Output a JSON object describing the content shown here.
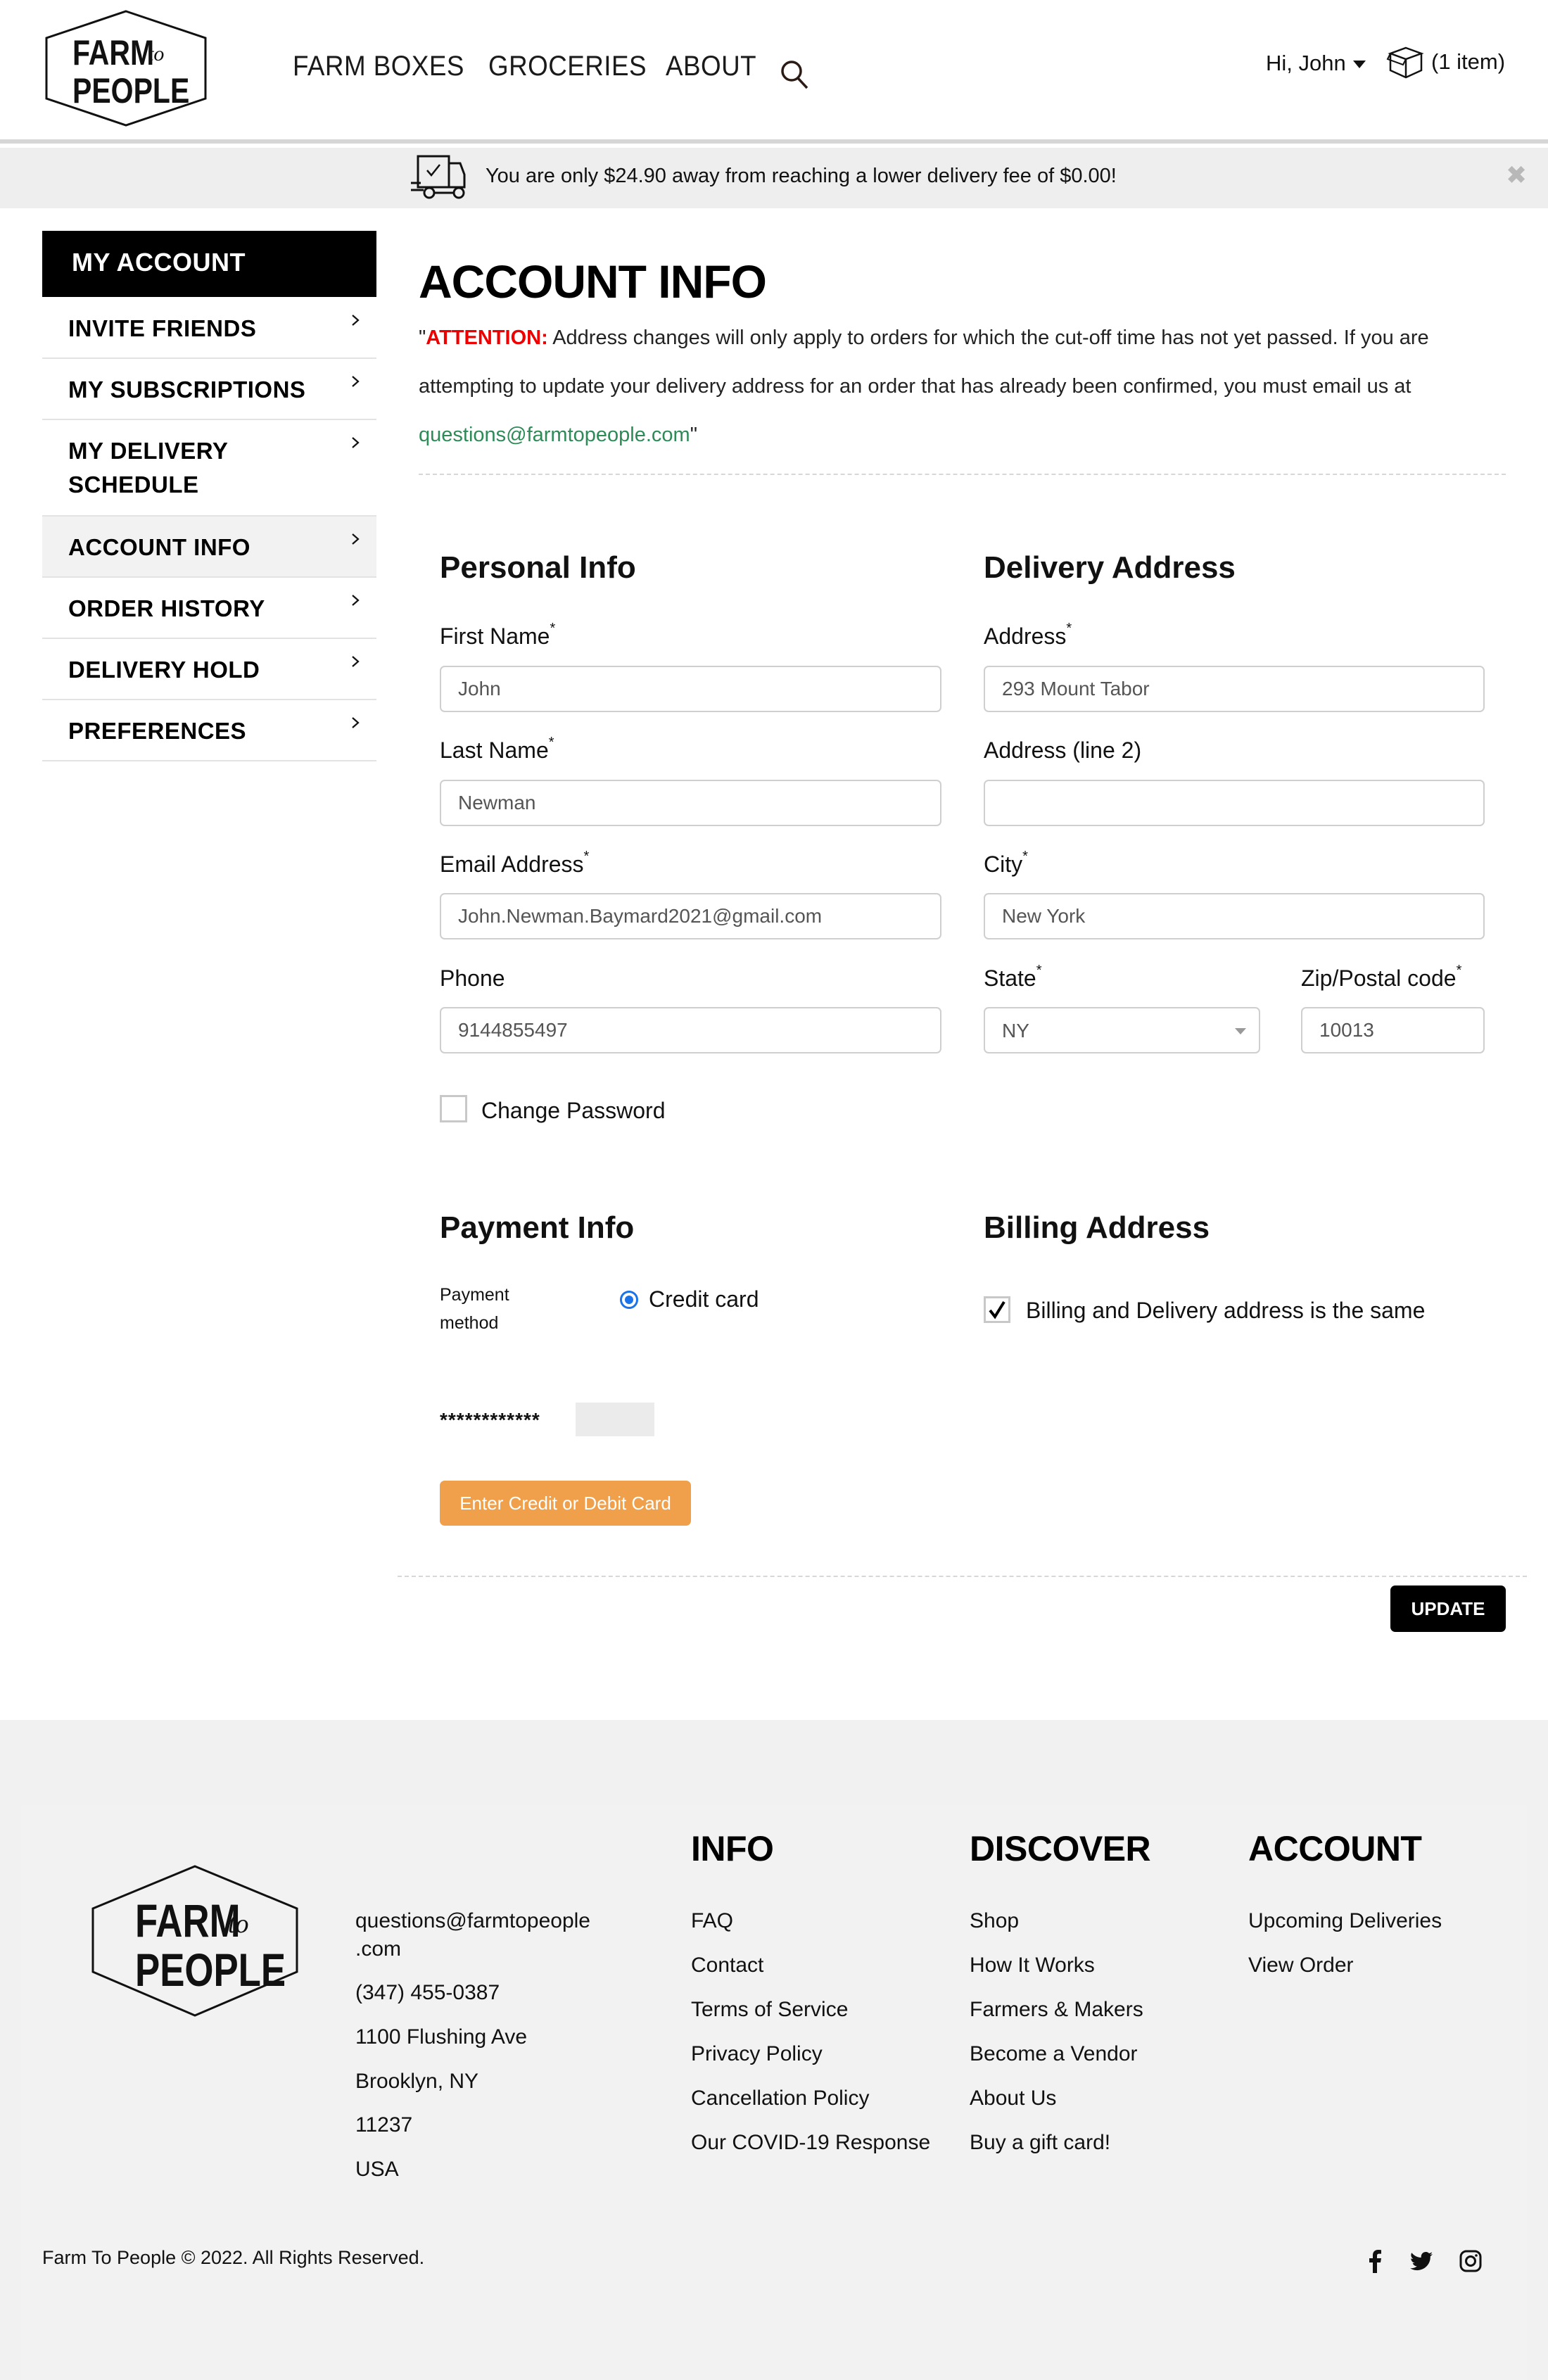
{
  "header": {
    "logo": {
      "line1": "FARM",
      "to": "to",
      "line2": "PEOPLE"
    },
    "nav": [
      "FARM BOXES",
      "GROCERIES",
      "ABOUT"
    ],
    "greeting": "Hi, John",
    "cart_label": "(1 item)"
  },
  "banner": {
    "message": "You are only $24.90 away from reaching a lower delivery fee of $0.00!",
    "close": "✖"
  },
  "sidebar": {
    "title": "MY ACCOUNT",
    "items": [
      {
        "label": "INVITE FRIENDS",
        "active": false
      },
      {
        "label": "MY SUBSCRIPTIONS",
        "active": false
      },
      {
        "label": "MY DELIVERY SCHEDULE",
        "active": false
      },
      {
        "label": "ACCOUNT INFO",
        "active": true
      },
      {
        "label": "ORDER HISTORY",
        "active": false
      },
      {
        "label": "DELIVERY HOLD",
        "active": false
      },
      {
        "label": "PREFERENCES",
        "active": false
      }
    ]
  },
  "main": {
    "title": "ACCOUNT INFO",
    "attention": {
      "open_quote": "\"",
      "label": "ATTENTION:",
      "text": " Address changes will only apply to orders for which the cut-off time has not yet passed. If you are attempting to update your delivery address for an order that has already been confirmed, you must email us at ",
      "email": "questions@farmtopeople.com",
      "close_quote": "\""
    },
    "personal": {
      "title": "Personal Info",
      "first_name": {
        "label": "First Name",
        "required": "*",
        "value": "John"
      },
      "last_name": {
        "label": "Last Name",
        "required": "*",
        "value": "Newman"
      },
      "email": {
        "label": "Email Address",
        "required": "*",
        "value": "John.Newman.Baymard2021@gmail.com"
      },
      "phone": {
        "label": "Phone",
        "value": "9144855497"
      },
      "change_password": {
        "label": "Change Password",
        "checked": false
      }
    },
    "delivery": {
      "title": "Delivery Address",
      "address": {
        "label": "Address",
        "required": "*",
        "value": "293 Mount Tabor"
      },
      "address2": {
        "label": "Address (line 2)",
        "value": ""
      },
      "city": {
        "label": "City",
        "required": "*",
        "value": "New York"
      },
      "state": {
        "label": "State",
        "required": "*",
        "value": "NY"
      },
      "zip": {
        "label": "Zip/Postal code",
        "required": "*",
        "value": "10013"
      }
    },
    "payment": {
      "title": "Payment Info",
      "method_label_1": "Payment",
      "method_label_2": "method",
      "method_option": "Credit card",
      "method_selected": true,
      "masked_card": "************",
      "enter_card_button": "Enter Credit or Debit Card"
    },
    "billing": {
      "title": "Billing Address",
      "same_as_delivery": {
        "label": "Billing and Delivery address is the same",
        "checked": true
      }
    },
    "update_button": "UPDATE"
  },
  "footer": {
    "logo": {
      "line1": "FARM",
      "to": "to",
      "line2": "PEOPLE"
    },
    "contact": {
      "email_line1": "questions@farmtopeople",
      "email_line2": ".com",
      "phone": "(347) 455-0387",
      "street": "1100 Flushing Ave",
      "city": "Brooklyn, NY",
      "zip": "11237",
      "country": "USA"
    },
    "columns": [
      {
        "title": "INFO",
        "links": [
          "FAQ",
          "Contact",
          "Terms of Service",
          "Privacy Policy",
          "Cancellation Policy",
          "Our COVID-19 Response"
        ]
      },
      {
        "title": "DISCOVER",
        "links": [
          "Shop",
          "How It Works",
          "Farmers & Makers",
          "Become a Vendor",
          "About Us",
          "Buy a gift card!"
        ]
      },
      {
        "title": "ACCOUNT",
        "links": [
          "Upcoming Deliveries",
          "View Order"
        ]
      }
    ],
    "copyright": "Farm To People © 2022. All Rights Reserved.",
    "social": [
      "facebook-icon",
      "twitter-icon",
      "instagram-icon"
    ]
  }
}
